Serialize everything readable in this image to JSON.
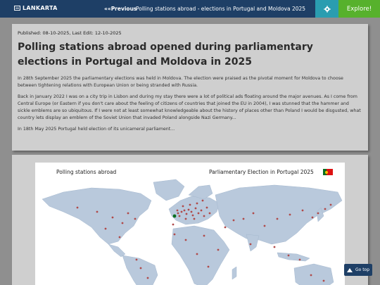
{
  "nav": {
    "logo": "LANKARTA",
    "prev": "««Previous",
    "title": "Polling stations abroad - elections in Portugal and Moldova 2025",
    "explore": "Explore!",
    "settings_icon": "gear-icon"
  },
  "article": {
    "published": "Published: 08-10-2025, Last Edit: 12-10-2025",
    "title": "Polling stations abroad opened during parliamentary elections in Portugal and Moldova in 2025",
    "paragraphs": [
      "In 28th September 2025 the parliamentary elections was held in Moldova. The election were praised as the pivotal moment for Moldova to choose between tightening relations with European Union or being stranded with Russia.",
      "Back in January 2022 I was on a city trip in Lisbon and during my stay there were a lot of political ads floating around the major avenues. As I come from Central Europe (or Eastern if you don't care about the feeling of citizens of countries that joined the EU in 2004), I was stunned that the hammer and sickle emblems are so ubiquitous. If I were not at least somewhat knowledgeable about the history of places other than Poland I would be disgusted, what country lets display an emblem of the Soviet Union that invaded Poland alongside Nazi Germany...",
      "In 18th May 2025 Portugal held election of its unicameral parliament..."
    ]
  },
  "map": {
    "left_title": "Polling stations abroad",
    "right_title": "Parliamentary Election in Portugal 2025",
    "flag_icon": "portugal-flag-icon",
    "land_color": "#b9c9dc",
    "marker_color": "#b04a4a"
  },
  "go_top": {
    "label": "Go top",
    "icon": "arrow-up-icon"
  }
}
